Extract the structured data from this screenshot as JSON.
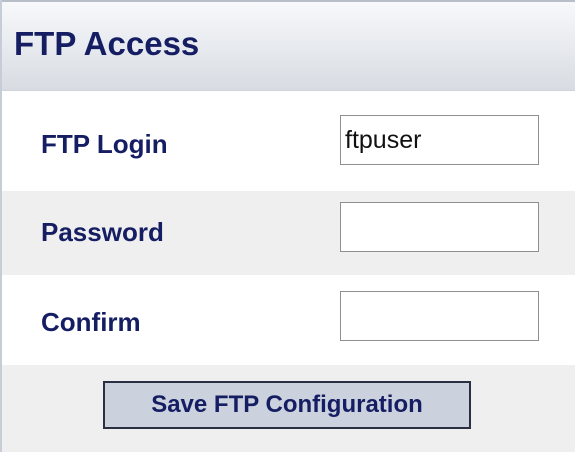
{
  "header": {
    "title": "FTP Access"
  },
  "form": {
    "login": {
      "label": "FTP Login",
      "value": "ftpuser"
    },
    "password": {
      "label": "Password",
      "value": ""
    },
    "confirm": {
      "label": "Confirm",
      "value": ""
    },
    "save_label": "Save FTP Configuration"
  },
  "colors": {
    "label_text": "#151e63",
    "alt_row_background": "#efefef",
    "button_background": "#ccd2dd"
  }
}
